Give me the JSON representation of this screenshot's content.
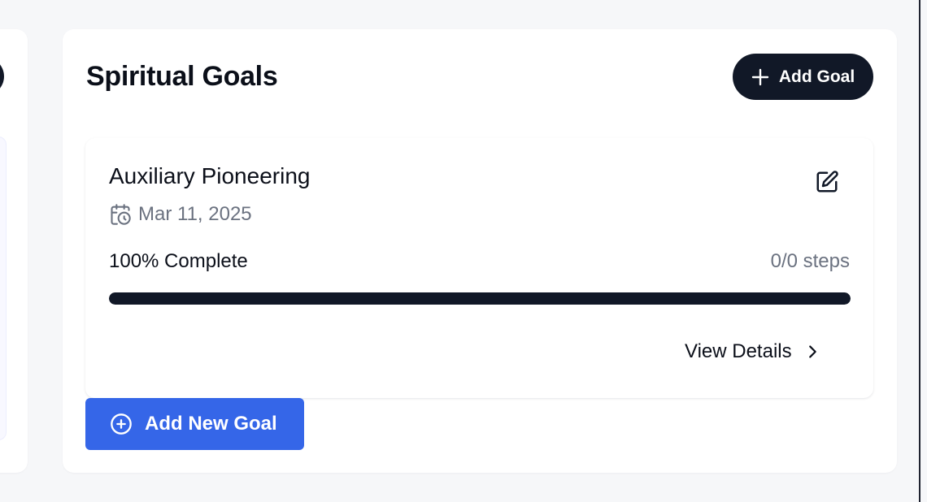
{
  "header": {
    "title": "Spiritual Goals",
    "add_goal_label": "Add Goal"
  },
  "goal": {
    "title": "Auxiliary Pioneering",
    "date": "Mar 11, 2025",
    "progress_label": "100% Complete",
    "progress_fraction": 1.0,
    "steps_label": "0/0 steps",
    "view_details_label": "View Details"
  },
  "footer": {
    "add_new_goal_label": "Add New Goal"
  },
  "colors": {
    "page_background": "#f6f7f9",
    "card_background": "#ffffff",
    "dark_button": "#111827",
    "primary_blue": "#3566e8",
    "muted_text": "#6b7280",
    "text": "#0b0f19"
  },
  "icons": {
    "add_goal": "plus-icon",
    "edit": "pencil-square-icon",
    "date": "calendar-clock-icon",
    "view_details": "chevron-right-icon",
    "add_new_goal": "plus-circle-icon"
  }
}
